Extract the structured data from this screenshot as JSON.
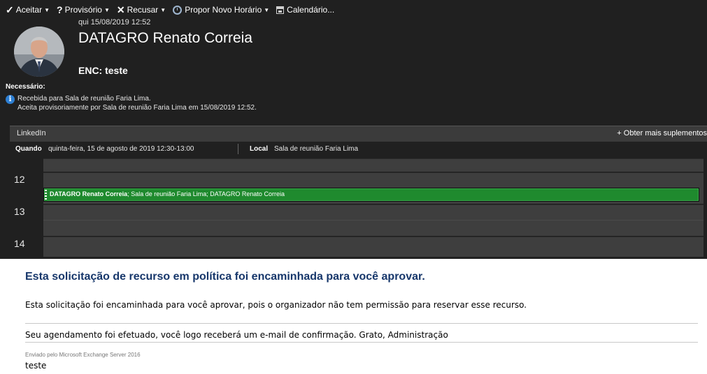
{
  "toolbar": {
    "accept_label": "Aceitar",
    "tentative_label": "Provisório",
    "decline_label": "Recusar",
    "propose_label": "Propor Novo Horário",
    "calendar_label": "Calendário..."
  },
  "header": {
    "date": "qui 15/08/2019 12:52",
    "sender": "DATAGRO Renato Correia",
    "subject": "ENC: teste",
    "required_label": "Necessário:"
  },
  "info": {
    "line1": "Recebida para Sala de reunião Faria Lima.",
    "line2": "Aceita provisoriamente por Sala de reunião Faria Lima em 15/08/2019 12:52."
  },
  "addins": {
    "name": "LinkedIn",
    "more_label": "+  Obter mais suplementos"
  },
  "meeting": {
    "when_label": "Quando",
    "when_value": "quinta-feira, 15 de agosto de 2019 12:30-13:00",
    "where_label": "Local",
    "where_value": "Sala de reunião Faria Lima"
  },
  "calendar": {
    "hours": [
      "12",
      "13",
      "14"
    ],
    "event_organizer": "DATAGRO Renato Correia",
    "event_rest": "; Sala de reunião Faria Lima; DATAGRO Renato Correia",
    "event_color": "#1f8a2e"
  },
  "body": {
    "heading": "Esta solicitação de recurso em política foi encaminhada para você aprovar.",
    "para1": "Esta solicitação foi encaminhada para você aprovar, pois o organizador não tem permissão para reservar esse recurso.",
    "para2": "Seu agendamento foi efetuado, você logo receberá um e-mail de confirmação. Grato, Administração",
    "sent_by": "Enviado pelo Microsoft Exchange Server 2016",
    "text": "teste"
  },
  "colors": {
    "background_dark": "#202020",
    "heading_color": "#17376b",
    "info_blue": "#2d7fd3"
  }
}
